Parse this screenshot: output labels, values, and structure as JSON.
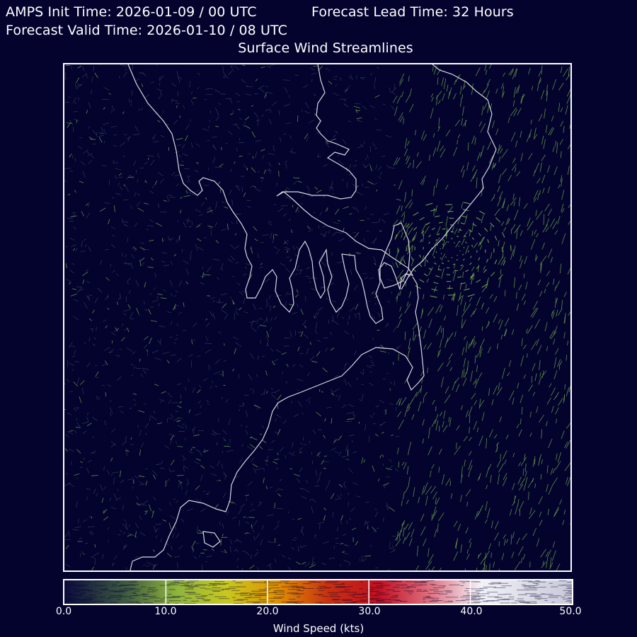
{
  "header": {
    "init_time": "AMPS Init Time: 2026-01-09 / 00 UTC",
    "lead_time": "Forecast Lead Time: 32 Hours",
    "valid_time": "Forecast Valid Time: 2026-01-10 / 08 UTC",
    "title": "Surface Wind Streamlines"
  },
  "colorbar": {
    "label": "Wind Speed (kts)",
    "ticks": [
      "0.0",
      "10.0",
      "20.0",
      "30.0",
      "40.0",
      "50.0"
    ],
    "range": [
      0,
      50
    ],
    "colors": [
      "#0a0a3c",
      "#5f7f3c",
      "#a8c840",
      "#e0c000",
      "#e07000",
      "#c01020",
      "#e07080",
      "#f0f0f8"
    ]
  },
  "map": {
    "background_color": "#03032e",
    "coastline_color": "#d8d8e0",
    "streamline_color": "#7dbb4c"
  }
}
